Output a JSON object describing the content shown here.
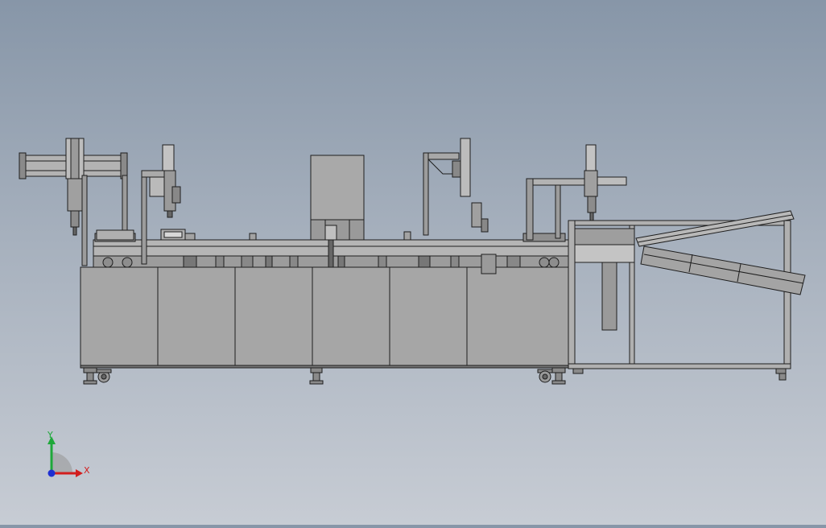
{
  "viewport": {
    "background_top": "#8796a8",
    "background_bottom": "#c7ccd4",
    "part_fill": "#a3a3a3",
    "part_light": "#b7b7b7",
    "part_dark": "#6f6f6f",
    "edge": "#1e1e1e"
  },
  "triad": {
    "x_label": "X",
    "y_label": "Y",
    "x_color": "#d21e1e",
    "y_color": "#1ea83a",
    "z_color": "#1e2fd2"
  }
}
